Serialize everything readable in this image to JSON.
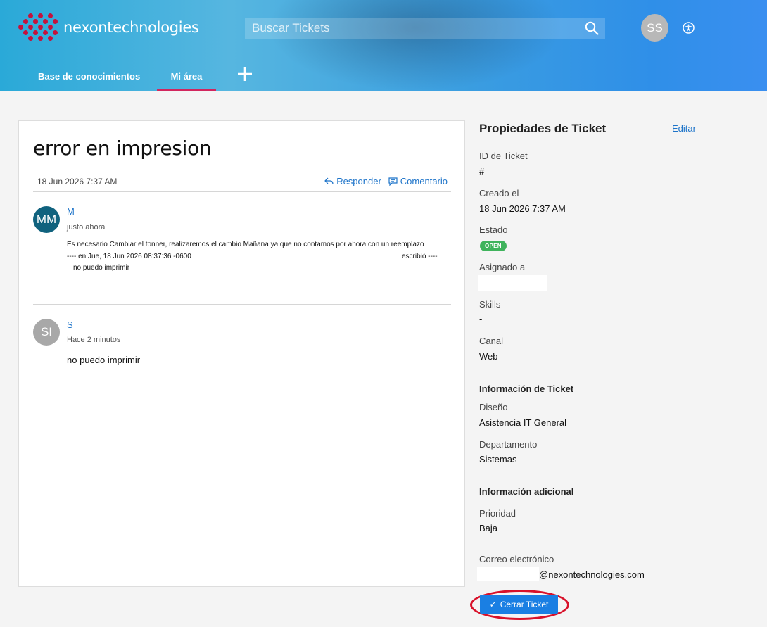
{
  "header": {
    "brand": "nexontechnologies",
    "search_placeholder": "Buscar Tickets",
    "user_initials": "SS",
    "nav": {
      "knowledge_base": "Base de conocimientos",
      "my_area": "Mi área"
    },
    "colors": {
      "accent_tab": "#d2265e",
      "logo_red": "#c4123d"
    }
  },
  "ticket": {
    "title": "error en impresion",
    "date": "18 Jun 2026 7:37 AM",
    "actions": {
      "reply": "Responder",
      "comment": "Comentario"
    },
    "thread": [
      {
        "initials": "MM",
        "author": "M",
        "time": "justo ahora",
        "lines": [
          "Es necesario Cambiar el tonner, realizaremos el cambio Mañana ya que no contamos por ahora con un reemplazo",
          "---- en Jue, 18 Jun 2026 08:37:36 -0600",
          "escribió ----",
          "no puedo imprimir"
        ]
      },
      {
        "initials": "SI",
        "author": "S",
        "time": "Hace 2 minutos",
        "message": "no puedo imprimir"
      }
    ]
  },
  "properties": {
    "title": "Propiedades de Ticket",
    "edit": "Editar",
    "ticket_id_label": "ID de Ticket",
    "ticket_id_value": "#",
    "created_label": "Creado el",
    "created_value": "18 Jun 2026 7:37 AM",
    "status_label": "Estado",
    "status_value": "OPEN",
    "assigned_label": "Asignado a",
    "skills_label": "Skills",
    "skills_value": "-",
    "channel_label": "Canal",
    "channel_value": "Web",
    "info_section": "Información de Ticket",
    "design_label": "Diseño",
    "design_value": "Asistencia IT General",
    "department_label": "Departamento",
    "department_value": "Sistemas",
    "extra_section": "Información adicional",
    "priority_label": "Prioridad",
    "priority_value": "Baja",
    "email_label": "Correo electrónico",
    "email_value": "@nexontechnologies.com",
    "close_button": "Cerrar Ticket",
    "colors": {
      "status_open": "#3fb35c",
      "button": "#1a7fe3",
      "highlight_circle": "#d8112a"
    }
  }
}
